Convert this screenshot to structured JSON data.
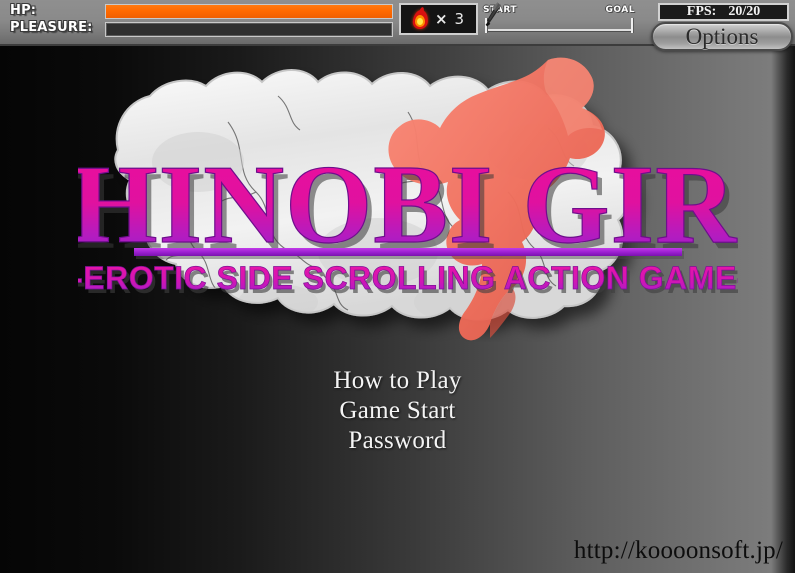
{
  "hud": {
    "hp_label": "HP:",
    "pleasure_label": "PLEASURE:",
    "hp_percent": 100,
    "pleasure_percent": 0,
    "hp_color": "#ff6a00",
    "lives_icon": "flame-icon",
    "lives_multiplier": "×",
    "lives_count": "3",
    "track_start_label": "START",
    "track_goal_label": "GOAL",
    "track_marker_icon": "kunai-icon",
    "track_progress_percent": 0,
    "fps_label": "FPS:",
    "fps_value": "20/20",
    "options_label": "Options"
  },
  "logo": {
    "title": "SHINOBI GIRL",
    "subtitle": "-EROTIC SIDE SCROLLING ACTION GAME-",
    "title_color": "#e6119e",
    "title_color_bottom": "#9a1fd0",
    "accent_bar_color": "#a01fd6",
    "plaque_color": "#e9e9e9",
    "character_color": "#f0705f"
  },
  "menu": {
    "items": [
      {
        "label": "How to Play"
      },
      {
        "label": "Game Start"
      },
      {
        "label": "Password"
      }
    ]
  },
  "footer": {
    "url": "http://koooonsoft.jp/"
  }
}
